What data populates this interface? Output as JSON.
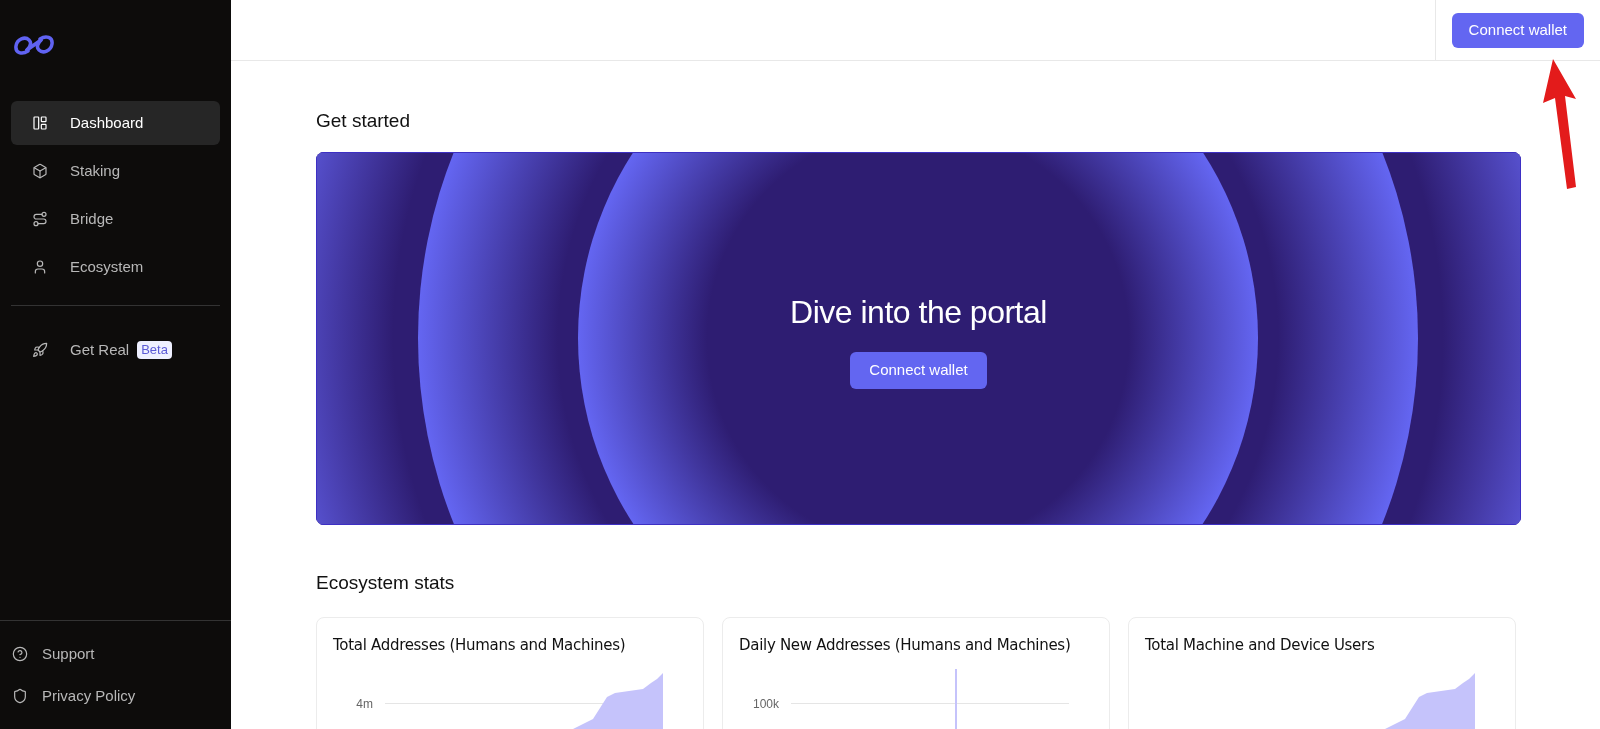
{
  "sidebar": {
    "nav_items": [
      {
        "label": "Dashboard",
        "selected": true
      },
      {
        "label": "Staking",
        "selected": false
      },
      {
        "label": "Bridge",
        "selected": false
      },
      {
        "label": "Ecosystem",
        "selected": false
      }
    ],
    "extra_items": [
      {
        "label": "Get Real",
        "badge": "Beta",
        "selected": false
      }
    ],
    "footer_items": [
      {
        "label": "Support"
      },
      {
        "label": "Privacy Policy"
      }
    ]
  },
  "header": {
    "connect_button": "Connect wallet"
  },
  "get_started": {
    "heading": "Get started",
    "banner": {
      "title": "Dive into the portal",
      "button": "Connect wallet"
    }
  },
  "stats": {
    "heading": "Ecosystem stats",
    "cards": [
      {
        "title": "Total Addresses (Humans and Machines)",
        "tick_label": "4m",
        "kind": "area"
      },
      {
        "title": "Daily New Addresses (Humans and Machines)",
        "tick_label": "100k",
        "kind": "spike"
      },
      {
        "title": "Total Machine and Device Users",
        "kind": "area"
      }
    ]
  }
}
